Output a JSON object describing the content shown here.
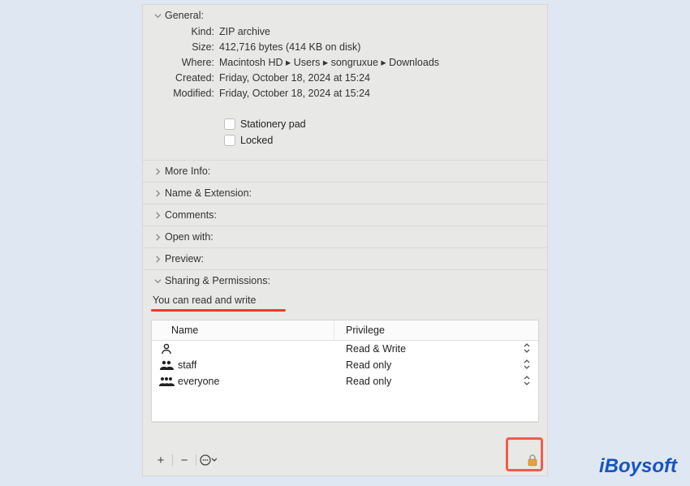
{
  "general": {
    "title": "General:",
    "rows": {
      "kind_label": "Kind:",
      "kind": "ZIP archive",
      "size_label": "Size:",
      "size": "412,716 bytes (414 KB on disk)",
      "where_label": "Where:",
      "where": "Macintosh HD ▸ Users ▸ songruxue ▸ Downloads",
      "created_label": "Created:",
      "created": "Friday, October 18, 2024 at 15:24",
      "modified_label": "Modified:",
      "modified": "Friday, October 18, 2024 at 15:24"
    },
    "stationery": "Stationery pad",
    "locked": "Locked"
  },
  "sections": {
    "moreinfo": "More Info:",
    "nameext": "Name & Extension:",
    "comments": "Comments:",
    "openwith": "Open with:",
    "preview": "Preview:",
    "sharing": "Sharing & Permissions:"
  },
  "permissions": {
    "summary": "You can read and write",
    "headers": {
      "name": "Name",
      "priv": "Privilege"
    },
    "rows": [
      {
        "name": "",
        "priv": "Read & Write",
        "icon": "user"
      },
      {
        "name": "staff",
        "priv": "Read only",
        "icon": "group2"
      },
      {
        "name": "everyone",
        "priv": "Read only",
        "icon": "group3"
      }
    ]
  },
  "logo": "iBoysoft"
}
